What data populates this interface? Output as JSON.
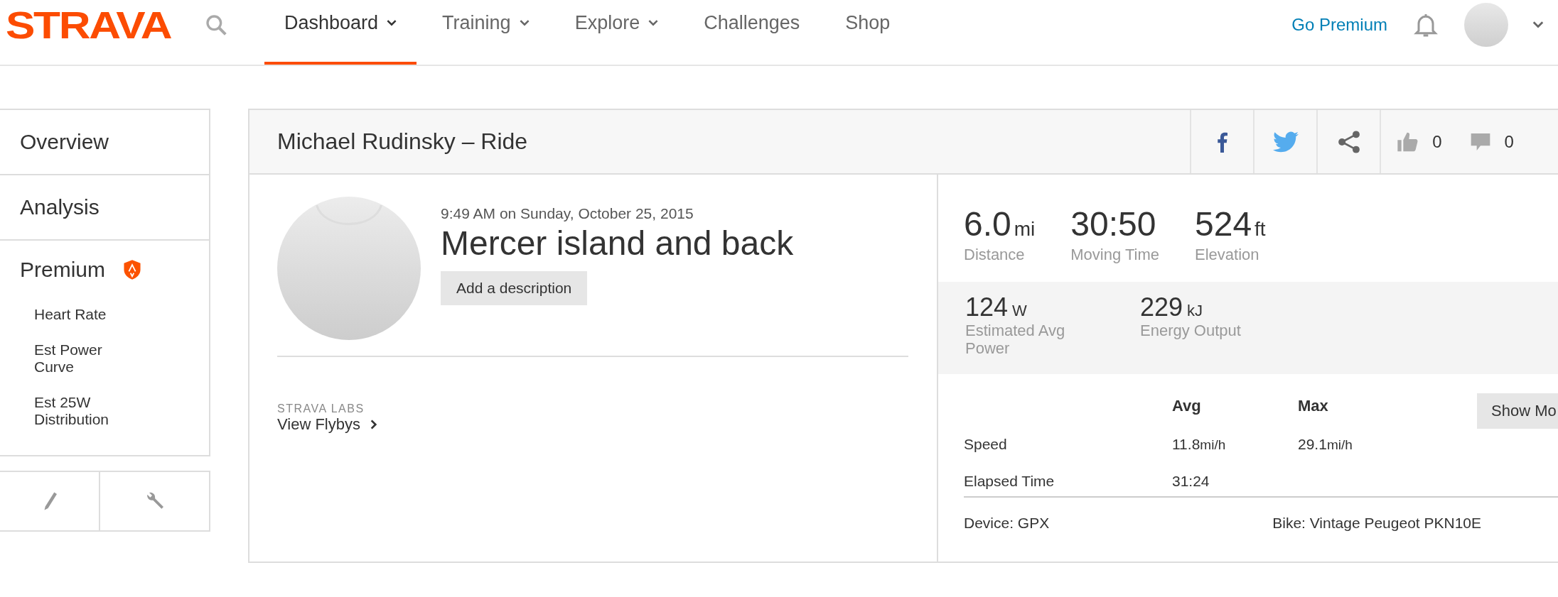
{
  "brand": {
    "logo": "STRAVA"
  },
  "nav": [
    {
      "label": "Dashboard",
      "selected": true,
      "dropdown": true
    },
    {
      "label": "Training",
      "selected": false,
      "dropdown": true
    },
    {
      "label": "Explore",
      "selected": false,
      "dropdown": true
    },
    {
      "label": "Challenges",
      "selected": false,
      "dropdown": false
    },
    {
      "label": "Shop",
      "selected": false,
      "dropdown": false
    }
  ],
  "header_right": {
    "premium_link": "Go Premium"
  },
  "sidebar": {
    "items": [
      {
        "label": "Overview"
      },
      {
        "label": "Analysis"
      }
    ],
    "premium": {
      "label": "Premium",
      "items": [
        "Heart Rate",
        "Est Power Curve",
        "Est 25W Distribution"
      ]
    }
  },
  "activity": {
    "title": "Michael Rudinsky – Ride",
    "kudos_count": "0",
    "comment_count": "0",
    "date": "9:49 AM on Sunday, October 25, 2015",
    "name": "Mercer island and back",
    "description_button": "Add a description",
    "labs_heading": "STRAVA LABS",
    "labs_link": "View Flybys",
    "primary_stats": [
      {
        "value": "6.0",
        "unit": "mi",
        "label": "Distance"
      },
      {
        "value": "30:50",
        "label": "Moving Time"
      },
      {
        "value": "524",
        "unit": "ft",
        "label": "Elevation"
      }
    ],
    "secondary_stats": [
      {
        "value": "124",
        "unit": "W",
        "label": "Estimated Avg Power"
      },
      {
        "value": "229",
        "unit": "kJ",
        "label": "Energy Output"
      }
    ],
    "table": {
      "columns": [
        "Avg",
        "Max"
      ],
      "rows": [
        {
          "label": "Speed",
          "avg": "11.8",
          "avg_unit": "mi/h",
          "max": "29.1",
          "max_unit": "mi/h"
        },
        {
          "label": "Elapsed Time",
          "avg": "31:24"
        }
      ]
    },
    "show_more": "Show Mo",
    "device": "Device: GPX",
    "bike": "Bike: Vintage Peugeot PKN10E"
  }
}
